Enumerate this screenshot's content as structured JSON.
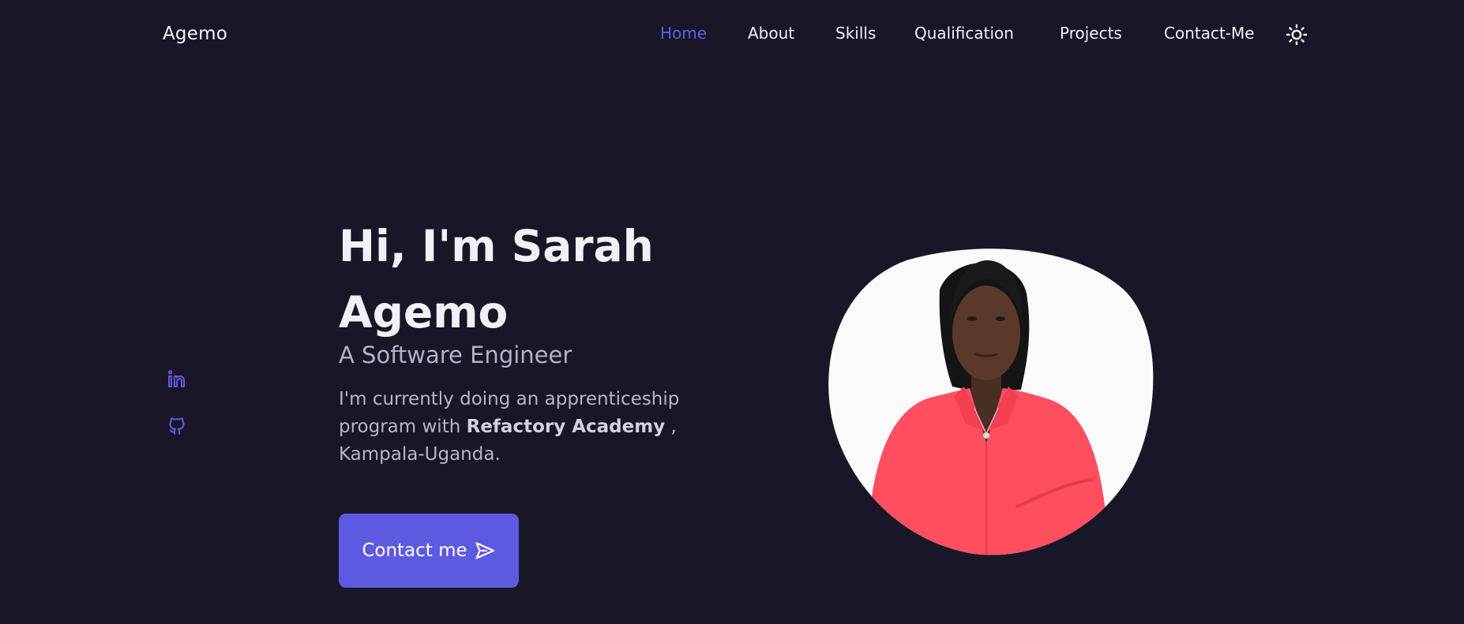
{
  "header": {
    "logo": "Agemo",
    "nav": [
      {
        "label": "Home",
        "active": true
      },
      {
        "label": "About",
        "active": false
      },
      {
        "label": "Skills",
        "active": false
      },
      {
        "label": "Qualification",
        "active": false
      },
      {
        "label": "Projects",
        "active": false
      },
      {
        "label": "Contact-Me",
        "active": false
      }
    ],
    "theme_toggle_icon": "sun-icon"
  },
  "social": {
    "items": [
      {
        "icon": "linkedin-icon"
      },
      {
        "icon": "github-icon"
      }
    ]
  },
  "hero": {
    "title": "Hi, I'm Sarah Agemo",
    "subtitle": "A Software Engineer",
    "description_before": "I'm currently doing an apprenticeship program with ",
    "description_bold": "Refactory Academy",
    "description_after": " , Kampala-Uganda.",
    "button_label": "Contact me",
    "button_icon": "send-icon",
    "image_icon": "profile-photo"
  },
  "colors": {
    "background": "#181627",
    "accent": "#5E5BE5",
    "text": "#F1F0F8",
    "muted_text": "#B7B5CA",
    "photo_shirt": "#FF4F5F"
  }
}
